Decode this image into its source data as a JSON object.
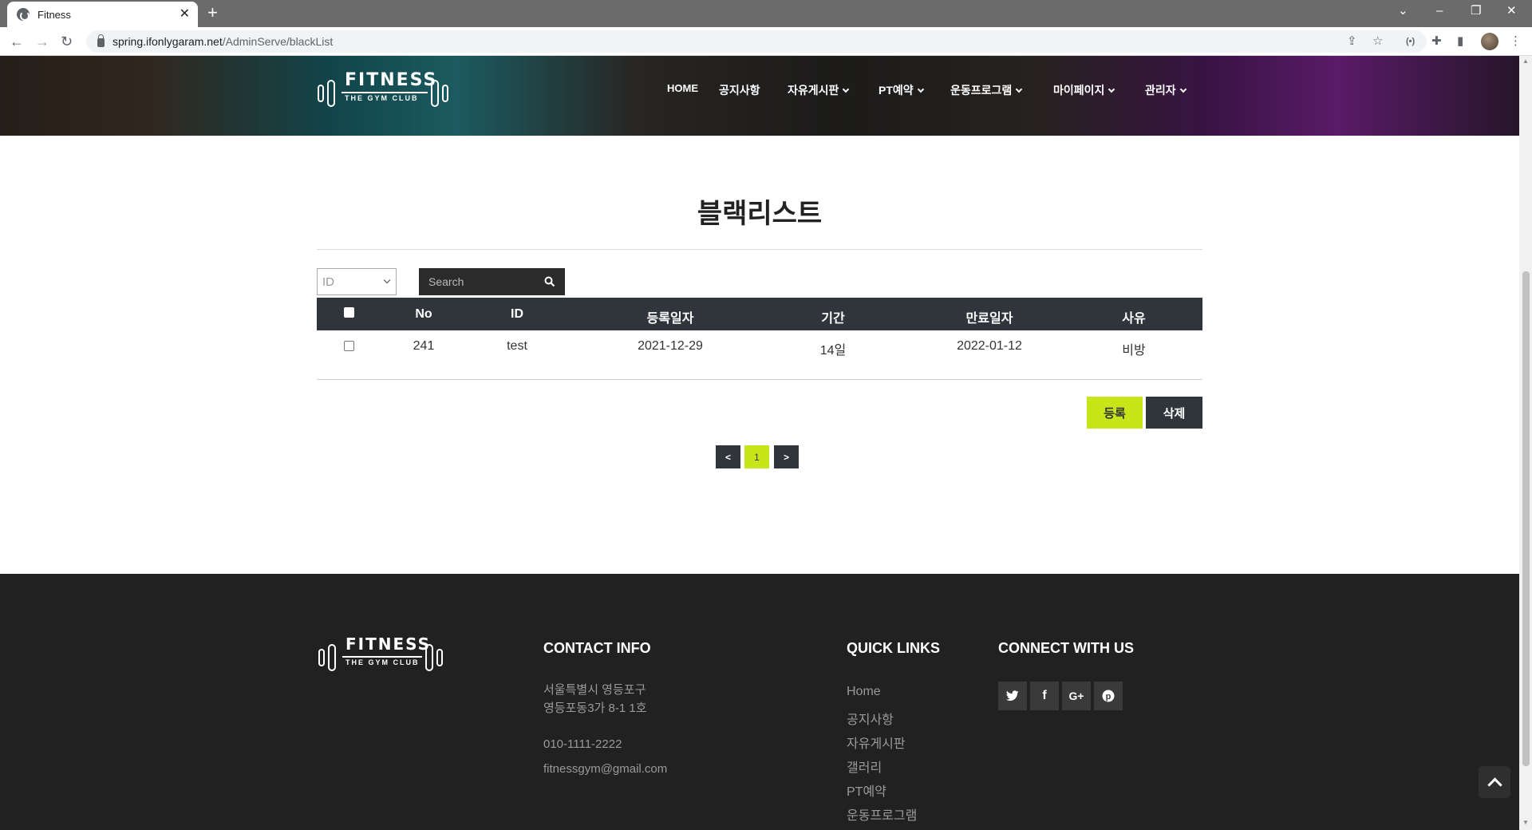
{
  "browser": {
    "tab_title": "Fitness",
    "url_host": "spring.ifonlygaram.net",
    "url_path": "/AdminServe/blackList"
  },
  "brand": {
    "logo_main": "FITNESS",
    "logo_sub": "THE GYM CLUB"
  },
  "nav": {
    "items": [
      {
        "label": "HOME",
        "dropdown": false
      },
      {
        "label": "공지사항",
        "dropdown": false
      },
      {
        "label": "자유게시판",
        "dropdown": true
      },
      {
        "label": "PT예약",
        "dropdown": true
      },
      {
        "label": "운동프로그램",
        "dropdown": true
      },
      {
        "label": "마이페이지",
        "dropdown": true
      },
      {
        "label": "관리자",
        "dropdown": true
      }
    ]
  },
  "page": {
    "title": "블랙리스트"
  },
  "filter": {
    "selected": "ID",
    "search_placeholder": "Search"
  },
  "table": {
    "headers": [
      "No",
      "ID",
      "등록일자",
      "기간",
      "만료일자",
      "사유"
    ],
    "rows": [
      {
        "no": "241",
        "id": "test",
        "registered": "2021-12-29",
        "period": "14일",
        "expires": "2022-01-12",
        "reason": "비방",
        "checked": false
      }
    ]
  },
  "actions": {
    "register_label": "등록",
    "delete_label": "삭제"
  },
  "pagination": {
    "prev": "<",
    "current": "1",
    "next": ">"
  },
  "footer": {
    "contact_heading": "CONTACT INFO",
    "address_line1": "서울특별시 영등포구",
    "address_line2": "영등포동3가 8-1 1호",
    "phone": "010-1111-2222",
    "email": "fitnessgym@gmail.com",
    "links_heading": "QUICK LINKS",
    "links": [
      "Home",
      "공지사항",
      "자유게시판",
      "갤러리",
      "PT예약",
      "운동프로그램"
    ],
    "connect_heading": "CONNECT WITH US",
    "social_icons": [
      "twitter-icon",
      "facebook-icon",
      "google-plus-icon",
      "pinterest-icon"
    ]
  },
  "colors": {
    "accent": "#c7e61a",
    "dark": "#30343b",
    "footer_bg": "#212121"
  }
}
